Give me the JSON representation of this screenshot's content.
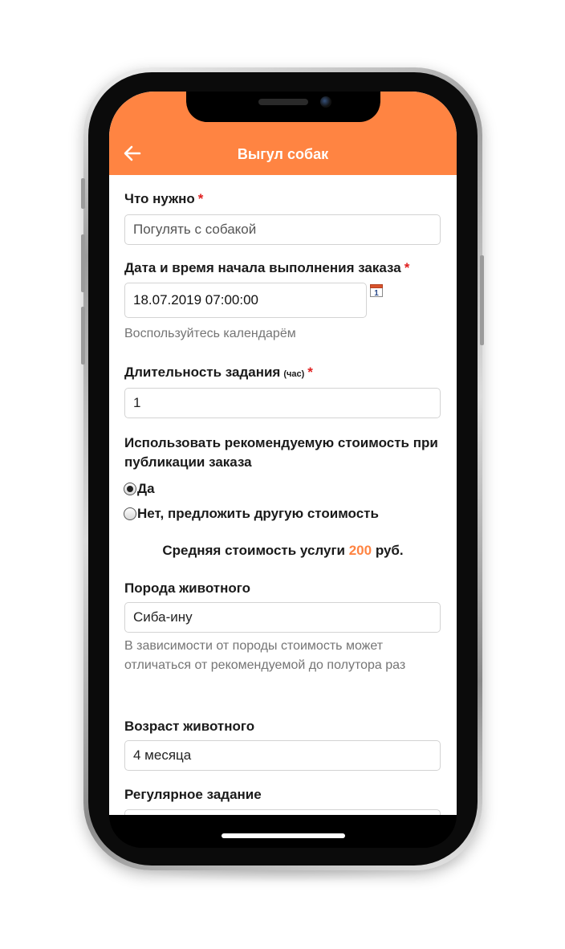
{
  "header": {
    "title": "Выгул собак",
    "back_icon": "arrow-left-icon"
  },
  "form": {
    "need": {
      "label": "Что нужно",
      "required": "*",
      "value": "Погулять с собакой"
    },
    "start_datetime": {
      "label": "Дата и время начала выполнения заказа",
      "required": "*",
      "value": "18.07.2019 07:00:00",
      "calendar_icon": "calendar-icon",
      "calendar_day": "1",
      "hint": "Воспользуйтесь календарём"
    },
    "duration": {
      "label": "Длительность задания",
      "unit": "(час)",
      "required": "*",
      "value": "1"
    },
    "recommended_price": {
      "question": "Использовать рекомендуемую стоимость при публикации заказа",
      "options": [
        {
          "label": "Да",
          "checked": true
        },
        {
          "label": "Нет, предложить другую стоимость",
          "checked": false
        }
      ]
    },
    "average_price": {
      "prefix": "Средняя стоимость услуги",
      "value": "200",
      "suffix": "руб."
    },
    "breed": {
      "label": "Порода животного",
      "value": "Сиба-ину",
      "hint": "В зависимости от породы стоимость может отличаться от рекомендуемой до полутора раз"
    },
    "age": {
      "label": "Возраст животного",
      "value": "4 месяца"
    },
    "regular": {
      "label": "Регулярное задание"
    }
  },
  "colors": {
    "accent": "#ff8442",
    "required": "#e02020",
    "hint": "#757575"
  }
}
